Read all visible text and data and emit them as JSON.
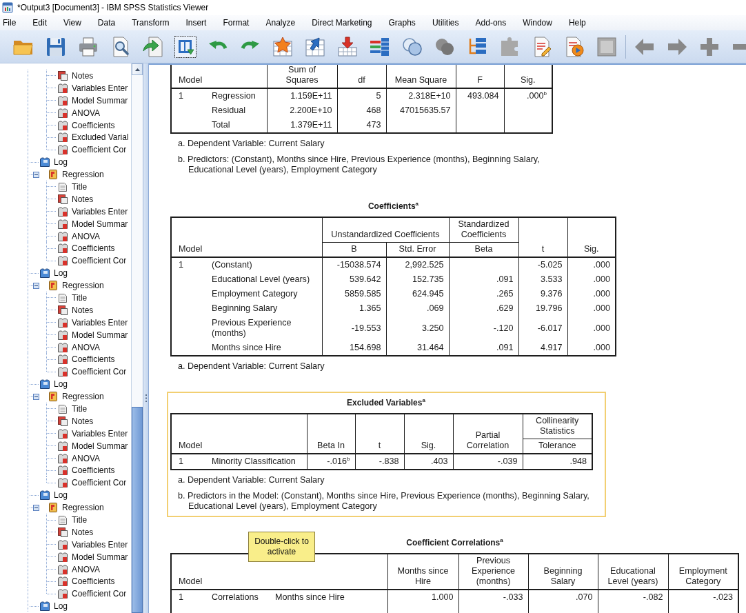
{
  "window": {
    "title": "*Output3 [Document3] - IBM SPSS Statistics Viewer"
  },
  "menu": [
    "File",
    "Edit",
    "View",
    "Data",
    "Transform",
    "Insert",
    "Format",
    "Analyze",
    "Direct Marketing",
    "Graphs",
    "Utilities",
    "Add-ons",
    "Window",
    "Help"
  ],
  "toolbar": [
    {
      "kind": "folder",
      "disabled": false,
      "pressed": false
    },
    {
      "kind": "save",
      "disabled": false,
      "pressed": false
    },
    {
      "kind": "printer",
      "disabled": false,
      "pressed": false
    },
    {
      "kind": "preview",
      "disabled": false,
      "pressed": false
    },
    {
      "kind": "export",
      "disabled": false,
      "pressed": false
    },
    {
      "kind": "panel",
      "disabled": false,
      "pressed": true
    },
    {
      "kind": "undo",
      "disabled": false,
      "pressed": false
    },
    {
      "kind": "redo",
      "disabled": false,
      "pressed": false
    },
    {
      "kind": "star-grid",
      "disabled": false,
      "pressed": false
    },
    {
      "kind": "grid-arrow",
      "disabled": false,
      "pressed": false
    },
    {
      "kind": "grid-down",
      "disabled": false,
      "pressed": false
    },
    {
      "kind": "bars",
      "disabled": false,
      "pressed": false
    },
    {
      "kind": "circles",
      "disabled": false,
      "pressed": false
    },
    {
      "kind": "spheres",
      "disabled": true,
      "pressed": false
    },
    {
      "kind": "tree-list",
      "disabled": false,
      "pressed": false
    },
    {
      "kind": "puzzle",
      "disabled": true,
      "pressed": false
    },
    {
      "kind": "doc-pencil",
      "disabled": false,
      "pressed": false
    },
    {
      "kind": "doc-play",
      "disabled": false,
      "pressed": false
    },
    {
      "kind": "square",
      "disabled": true,
      "pressed": false
    },
    {
      "kind": "separator"
    },
    {
      "kind": "left",
      "disabled": true,
      "pressed": false
    },
    {
      "kind": "right",
      "disabled": true,
      "pressed": false
    },
    {
      "kind": "plus",
      "disabled": true,
      "pressed": false
    },
    {
      "kind": "minus",
      "disabled": true,
      "pressed": false
    }
  ],
  "outline": [
    {
      "children": [
        {
          "label": "Notes",
          "kind": "notes"
        },
        {
          "label": "Variables Enter",
          "kind": "table"
        },
        {
          "label": "Model Summar",
          "kind": "table"
        },
        {
          "label": "ANOVA",
          "kind": "table"
        },
        {
          "label": "Coefficients",
          "kind": "table"
        },
        {
          "label": "Excluded Varial",
          "kind": "table"
        },
        {
          "label": "Coefficient Cor",
          "kind": "table"
        }
      ]
    },
    {
      "label": "Log",
      "kind": "log"
    },
    {
      "label": "Regression",
      "kind": "procedure",
      "expanded": true,
      "children": [
        {
          "label": "Title",
          "kind": "title"
        },
        {
          "label": "Notes",
          "kind": "notes"
        },
        {
          "label": "Variables Enter",
          "kind": "table"
        },
        {
          "label": "Model Summar",
          "kind": "table"
        },
        {
          "label": "ANOVA",
          "kind": "table"
        },
        {
          "label": "Coefficients",
          "kind": "table"
        },
        {
          "label": "Coefficient Cor",
          "kind": "table"
        }
      ]
    },
    {
      "label": "Log",
      "kind": "log"
    },
    {
      "label": "Regression",
      "kind": "procedure",
      "expanded": true,
      "children": [
        {
          "label": "Title",
          "kind": "title"
        },
        {
          "label": "Notes",
          "kind": "notes"
        },
        {
          "label": "Variables Enter",
          "kind": "table"
        },
        {
          "label": "Model Summar",
          "kind": "table"
        },
        {
          "label": "ANOVA",
          "kind": "table"
        },
        {
          "label": "Coefficients",
          "kind": "table"
        },
        {
          "label": "Coefficient Cor",
          "kind": "table"
        }
      ]
    },
    {
      "label": "Log",
      "kind": "log"
    },
    {
      "label": "Regression",
      "kind": "procedure",
      "expanded": true,
      "children": [
        {
          "label": "Title",
          "kind": "title"
        },
        {
          "label": "Notes",
          "kind": "notes"
        },
        {
          "label": "Variables Enter",
          "kind": "table"
        },
        {
          "label": "Model Summar",
          "kind": "table"
        },
        {
          "label": "ANOVA",
          "kind": "table"
        },
        {
          "label": "Coefficients",
          "kind": "table"
        },
        {
          "label": "Coefficient Cor",
          "kind": "table"
        }
      ]
    },
    {
      "label": "Log",
      "kind": "log"
    },
    {
      "label": "Regression",
      "kind": "procedure",
      "expanded": true,
      "children": [
        {
          "label": "Title",
          "kind": "title"
        },
        {
          "label": "Notes",
          "kind": "notes"
        },
        {
          "label": "Variables Enter",
          "kind": "table"
        },
        {
          "label": "Model Summar",
          "kind": "table"
        },
        {
          "label": "ANOVA",
          "kind": "table"
        },
        {
          "label": "Coefficients",
          "kind": "table"
        },
        {
          "label": "Coefficient Cor",
          "kind": "table"
        }
      ]
    },
    {
      "label": "Log",
      "kind": "log"
    }
  ],
  "output": [
    {
      "selected": false,
      "stub_label": "Model",
      "columns": [
        {
          "label": "Sum of Squares"
        },
        {
          "label": "df"
        },
        {
          "label": "Mean Square"
        },
        {
          "label": "F"
        },
        {
          "label": "Sig."
        }
      ],
      "rows": [
        {
          "model": "1",
          "term": "Regression",
          "cells": [
            {
              "value": "1.159E+11"
            },
            {
              "value": "5"
            },
            {
              "value": "2.318E+10"
            },
            {
              "value": "493.084"
            },
            {
              "value": ".000$^{b}$"
            }
          ]
        },
        {
          "term": "Residual",
          "cells": [
            {
              "value": "2.200E+10"
            },
            {
              "value": "468"
            },
            {
              "value": "47015635.57"
            }
          ]
        },
        {
          "term": "Total",
          "cells": [
            {
              "value": "1.379E+11"
            },
            {
              "value": "473"
            }
          ]
        }
      ],
      "notes": [
        "a. Dependent Variable: Current Salary",
        "b. Predictors: (Constant), Months since Hire, Previous Experience (months), Beginning Salary, Educational Level (years), Employment Category"
      ]
    },
    {
      "selected": false,
      "title": "Coefficients$^{a}$",
      "stub_label": "Model",
      "columns": [
        {
          "label": "Unstandardized Coefficients",
          "colspan": 2,
          "sub": [
            "B",
            "Std. Error"
          ]
        },
        {
          "label": "Standardized Coefficients",
          "sub": [
            "Beta"
          ]
        },
        {
          "label": "t"
        },
        {
          "label": "Sig."
        }
      ],
      "rows": [
        {
          "model": "1",
          "term": "(Constant)",
          "cells": [
            {
              "value": "-15038.574"
            },
            {
              "value": "2,992.525"
            },
            {},
            {
              "value": "-5.025"
            },
            {
              "value": ".000"
            }
          ]
        },
        {
          "term": "Educational Level (years)",
          "cells": [
            {
              "value": "539.642"
            },
            {
              "value": "152.735"
            },
            {
              "value": ".091"
            },
            {
              "value": "3.533"
            },
            {
              "value": ".000"
            }
          ]
        },
        {
          "term": "Employment Category",
          "cells": [
            {
              "value": "5859.585"
            },
            {
              "value": "624.945"
            },
            {
              "value": ".265"
            },
            {
              "value": "9.376"
            },
            {
              "value": ".000"
            }
          ]
        },
        {
          "term": "Beginning Salary",
          "cells": [
            {
              "value": "1.365"
            },
            {
              "value": ".069"
            },
            {
              "value": ".629"
            },
            {
              "value": "19.796"
            },
            {
              "value": ".000"
            }
          ]
        },
        {
          "term": "Previous Experience (months)",
          "cells": [
            {
              "value": "-19.553"
            },
            {
              "value": "3.250"
            },
            {
              "value": "-.120"
            },
            {
              "value": "-6.017"
            },
            {
              "value": ".000"
            }
          ]
        },
        {
          "term": "Months since Hire",
          "cells": [
            {
              "value": "154.698"
            },
            {
              "value": "31.464"
            },
            {
              "value": ".091"
            },
            {
              "value": "4.917"
            },
            {
              "value": ".000"
            }
          ]
        }
      ],
      "notes": [
        "a. Dependent Variable: Current Salary"
      ]
    },
    {
      "selected": true,
      "title": "Excluded Variables$^{a}$",
      "stub_label": "Model",
      "columns": [
        {
          "label": "Beta In"
        },
        {
          "label": "t"
        },
        {
          "label": "Sig."
        },
        {
          "label": "Partial Correlation"
        },
        {
          "label": "Collinearity Statistics",
          "sub": [
            "Tolerance"
          ]
        }
      ],
      "rows": [
        {
          "model": "1",
          "term": "Minority Classification",
          "cells": [
            {
              "value": "-.016$^{b}$"
            },
            {
              "value": "-.838"
            },
            {
              "value": ".403"
            },
            {
              "value": "-.039"
            },
            {
              "value": ".948"
            }
          ]
        }
      ],
      "notes": [
        "a. Dependent Variable: Current Salary",
        "b. Predictors in the Model: (Constant), Months since Hire, Previous Experience (months), Beginning Salary, Educational Level (years), Employment Category"
      ]
    },
    {
      "selected": false,
      "title": "Coefficient Correlations$^{a}$",
      "stub_label": "Model",
      "columns": [
        {
          "label": "Months since Hire"
        },
        {
          "label": "Previous Experience (months)"
        },
        {
          "label": "Beginning Salary"
        },
        {
          "label": "Educational Level (years)"
        },
        {
          "label": "Employment Category"
        }
      ],
      "rows": [
        {
          "model": "1",
          "statistic": "Correlations",
          "term": "Months since Hire",
          "cells": [
            {
              "value": "1.000"
            },
            {
              "value": "-.033"
            },
            {
              "value": ".070"
            },
            {
              "value": "-.082"
            },
            {
              "value": "-.023"
            }
          ]
        }
      ]
    }
  ],
  "tooltip": "Double-click to activate"
}
